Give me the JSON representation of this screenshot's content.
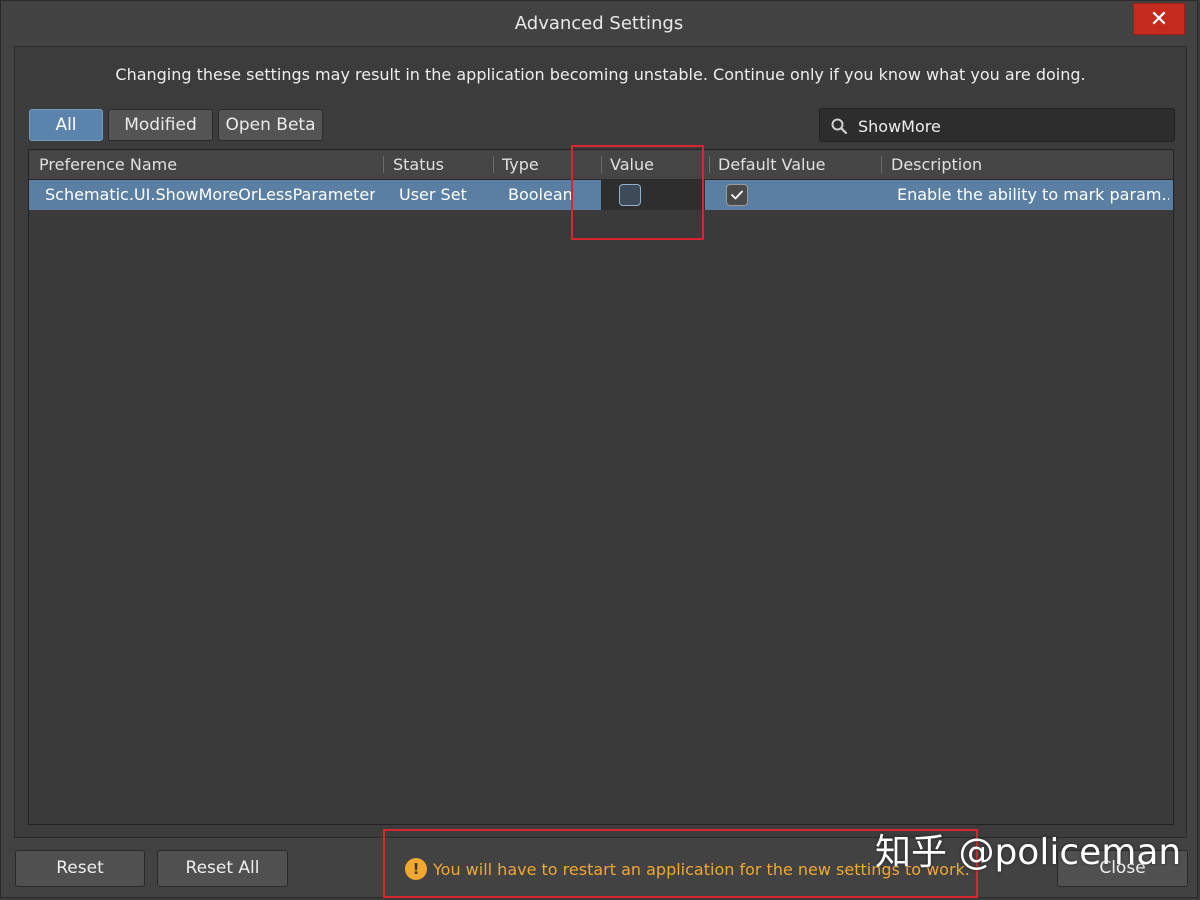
{
  "window": {
    "title": "Advanced Settings",
    "close_glyph": "✕"
  },
  "warning": "Changing these settings may result in the application becoming unstable. Continue only if you know what you are doing.",
  "filters": [
    {
      "label": "All",
      "active": true
    },
    {
      "label": "Modified",
      "active": false
    },
    {
      "label": "Open Beta",
      "active": false
    }
  ],
  "search": {
    "value": "ShowMore",
    "icon": "search-icon"
  },
  "table": {
    "columns": [
      "Preference Name",
      "Status",
      "Type",
      "Value",
      "Default Value",
      "Description"
    ],
    "rows": [
      {
        "name": "Schematic.UI.ShowMoreOrLessParameters",
        "status": "User Set",
        "type": "Boolean",
        "value": false,
        "default_value": true,
        "description": "Enable the ability to mark param..."
      }
    ]
  },
  "footer": {
    "reset_label": "Reset",
    "reset_all_label": "Reset All",
    "restart_message": "You will have to restart an application for the new settings to work.",
    "restart_icon_glyph": "!",
    "close_label": "Close"
  },
  "watermark": "知乎 @policeman",
  "colors": {
    "accent": "#5b84ad",
    "selected_row": "#5a7fa3",
    "close_red": "#c42b1c",
    "warning_orange": "#f0a830",
    "annotation_red": "#d8262f"
  }
}
